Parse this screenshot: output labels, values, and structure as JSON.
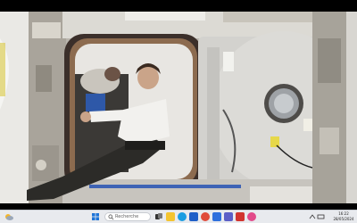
{
  "taskbar": {
    "search_placeholder": "Recherche",
    "time": "16:22",
    "date": "28/05/2024"
  },
  "icons": [
    "weather-icon",
    "windows-start-icon",
    "search-icon",
    "task-view-icon",
    "file-explorer-icon",
    "edge-icon",
    "mail-icon",
    "chrome-icon",
    "store-icon",
    "teams-icon",
    "app-icon",
    "media-icon",
    "system-tray-icon"
  ],
  "colors": {
    "taskbar": "#e8eaee",
    "hatch": "#d8d8d4",
    "walls": "#b7b2aa"
  }
}
